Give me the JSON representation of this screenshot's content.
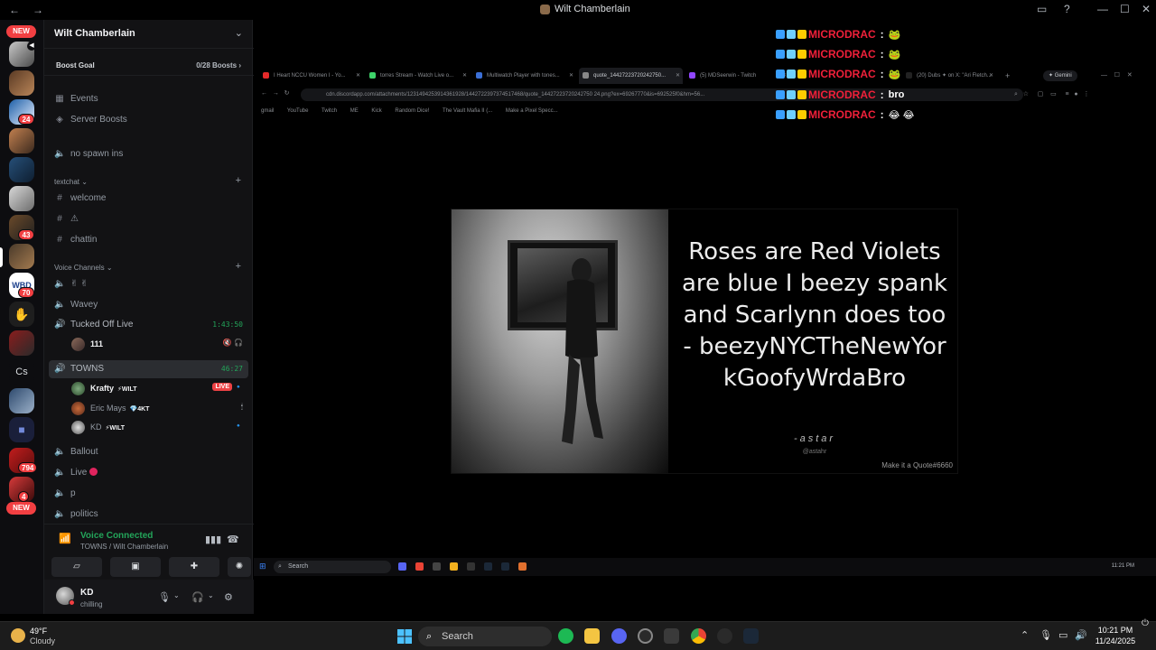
{
  "window": {
    "title": "Wilt Chamberlain",
    "back": "←",
    "forward": "→",
    "inbox_icon": "▭",
    "help_icon": "?",
    "minimize": "—",
    "maximize": "☐",
    "close": "✕"
  },
  "rail": {
    "new_top": "NEW",
    "new_bottom": "NEW",
    "badges": [
      "24",
      "43",
      "70",
      "794",
      "4"
    ],
    "letters_server": "Cs"
  },
  "server": {
    "name": "Wilt Chamberlain",
    "chevron": "⌄",
    "boost_goal": "Boost Goal",
    "boost_count": "0/28 Boosts ›"
  },
  "channels": {
    "events": "Events",
    "server_boosts": "Server Boosts",
    "no_spawn": "no spawn ins",
    "cat_textchat": "textchat ⌄",
    "welcome": "welcome",
    "warning": "⚠",
    "chattin": "chattin",
    "cat_voice": "Voice Channels ⌄",
    "hands": "✌ ✌",
    "wavey": "Wavey",
    "tucked": "Tucked Off Live",
    "tucked_time": "1:43:50",
    "tucked_user_tag": "111",
    "towns": "TOWNS",
    "towns_time": "46:27",
    "ballout": "Ballout",
    "live": "Live",
    "p": "p",
    "politics": "politics",
    "plus": "+"
  },
  "voice_users": [
    {
      "name": "Krafty",
      "tag": "⚡WILT",
      "live": "LIVE"
    },
    {
      "name": "Eric Mays",
      "tag": "💎4KT"
    },
    {
      "name": "KD",
      "tag": "⚡WILT"
    }
  ],
  "voice_panel": {
    "status": "Voice Connected",
    "location": "TOWNS / Wilt Chamberlain"
  },
  "user": {
    "name": "KD",
    "status": "chilling"
  },
  "stream": {
    "tabs": [
      "I Heart NCCU Women I - Yo...",
      "torres Stream - Watch Live o...",
      "Multiwatch Player with tones...",
      "quote_14427223720242750...",
      "(5) MDSeerwin - Twitch",
      "(20) Dubs ✦ on X: \"Ari Fletch..."
    ],
    "gemini": "✦ Gemini",
    "url": "cdn.discordapp.com/attachments/1231494253914361928/1442722397374517468/quote_14427223720242750 24.png?ex=69267770&is=692525f0&hm=56...",
    "bookmarks": [
      "gmail",
      "YouTube",
      "Twitch",
      "ME",
      "Kick",
      "Random Dice!",
      "The Vault Mafia II (...",
      "Make a Pixel Specc..."
    ],
    "chat": [
      {
        "user": "MICRODRAC",
        "msg": "🐸"
      },
      {
        "user": "MICRODRAC",
        "msg": "🐸"
      },
      {
        "user": "MICRODRAC",
        "msg": "🐸"
      },
      {
        "user": "MICRODRAC",
        "msg": "bro"
      },
      {
        "user": "MICRODRAC",
        "msg": "😂 😂"
      }
    ],
    "quote": {
      "text": "Roses are Red Violets are blue I beezy spank and Scarlynn does too - beezyNYCTheNewYor kGoofyWrdaBro",
      "author": "-astar",
      "handle": "@astahr",
      "watermark": "Make it a Quote#6660"
    },
    "inner_taskbar": {
      "search": "Search",
      "clock": "11:21 PM"
    }
  },
  "taskbar": {
    "temp": "49°F",
    "condition": "Cloudy",
    "search": "Search",
    "time": "10:21 PM",
    "date": "11/24/2025"
  }
}
